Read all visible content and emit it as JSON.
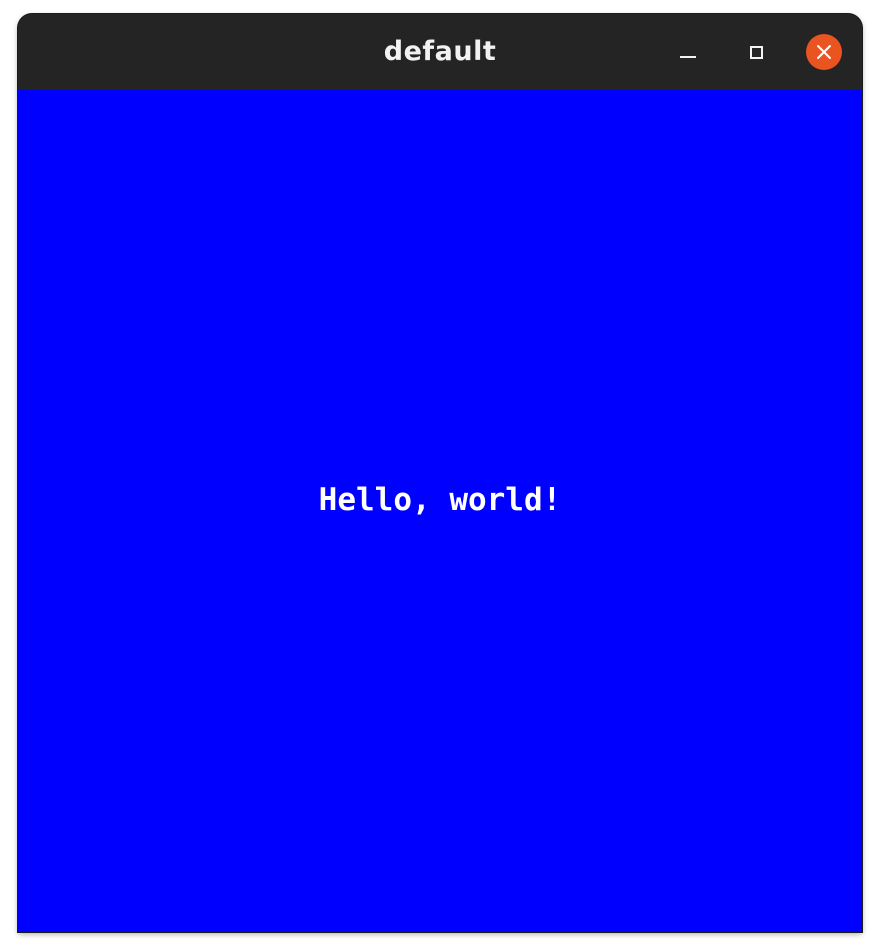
{
  "window": {
    "title": "default",
    "controls": {
      "minimize_icon": "minimize-icon",
      "maximize_icon": "maximize-icon",
      "close_icon": "close-icon",
      "close_color": "#e95420"
    }
  },
  "content": {
    "background_color": "#0000ff",
    "text": "Hello, world!",
    "text_color": "#ffffff"
  }
}
